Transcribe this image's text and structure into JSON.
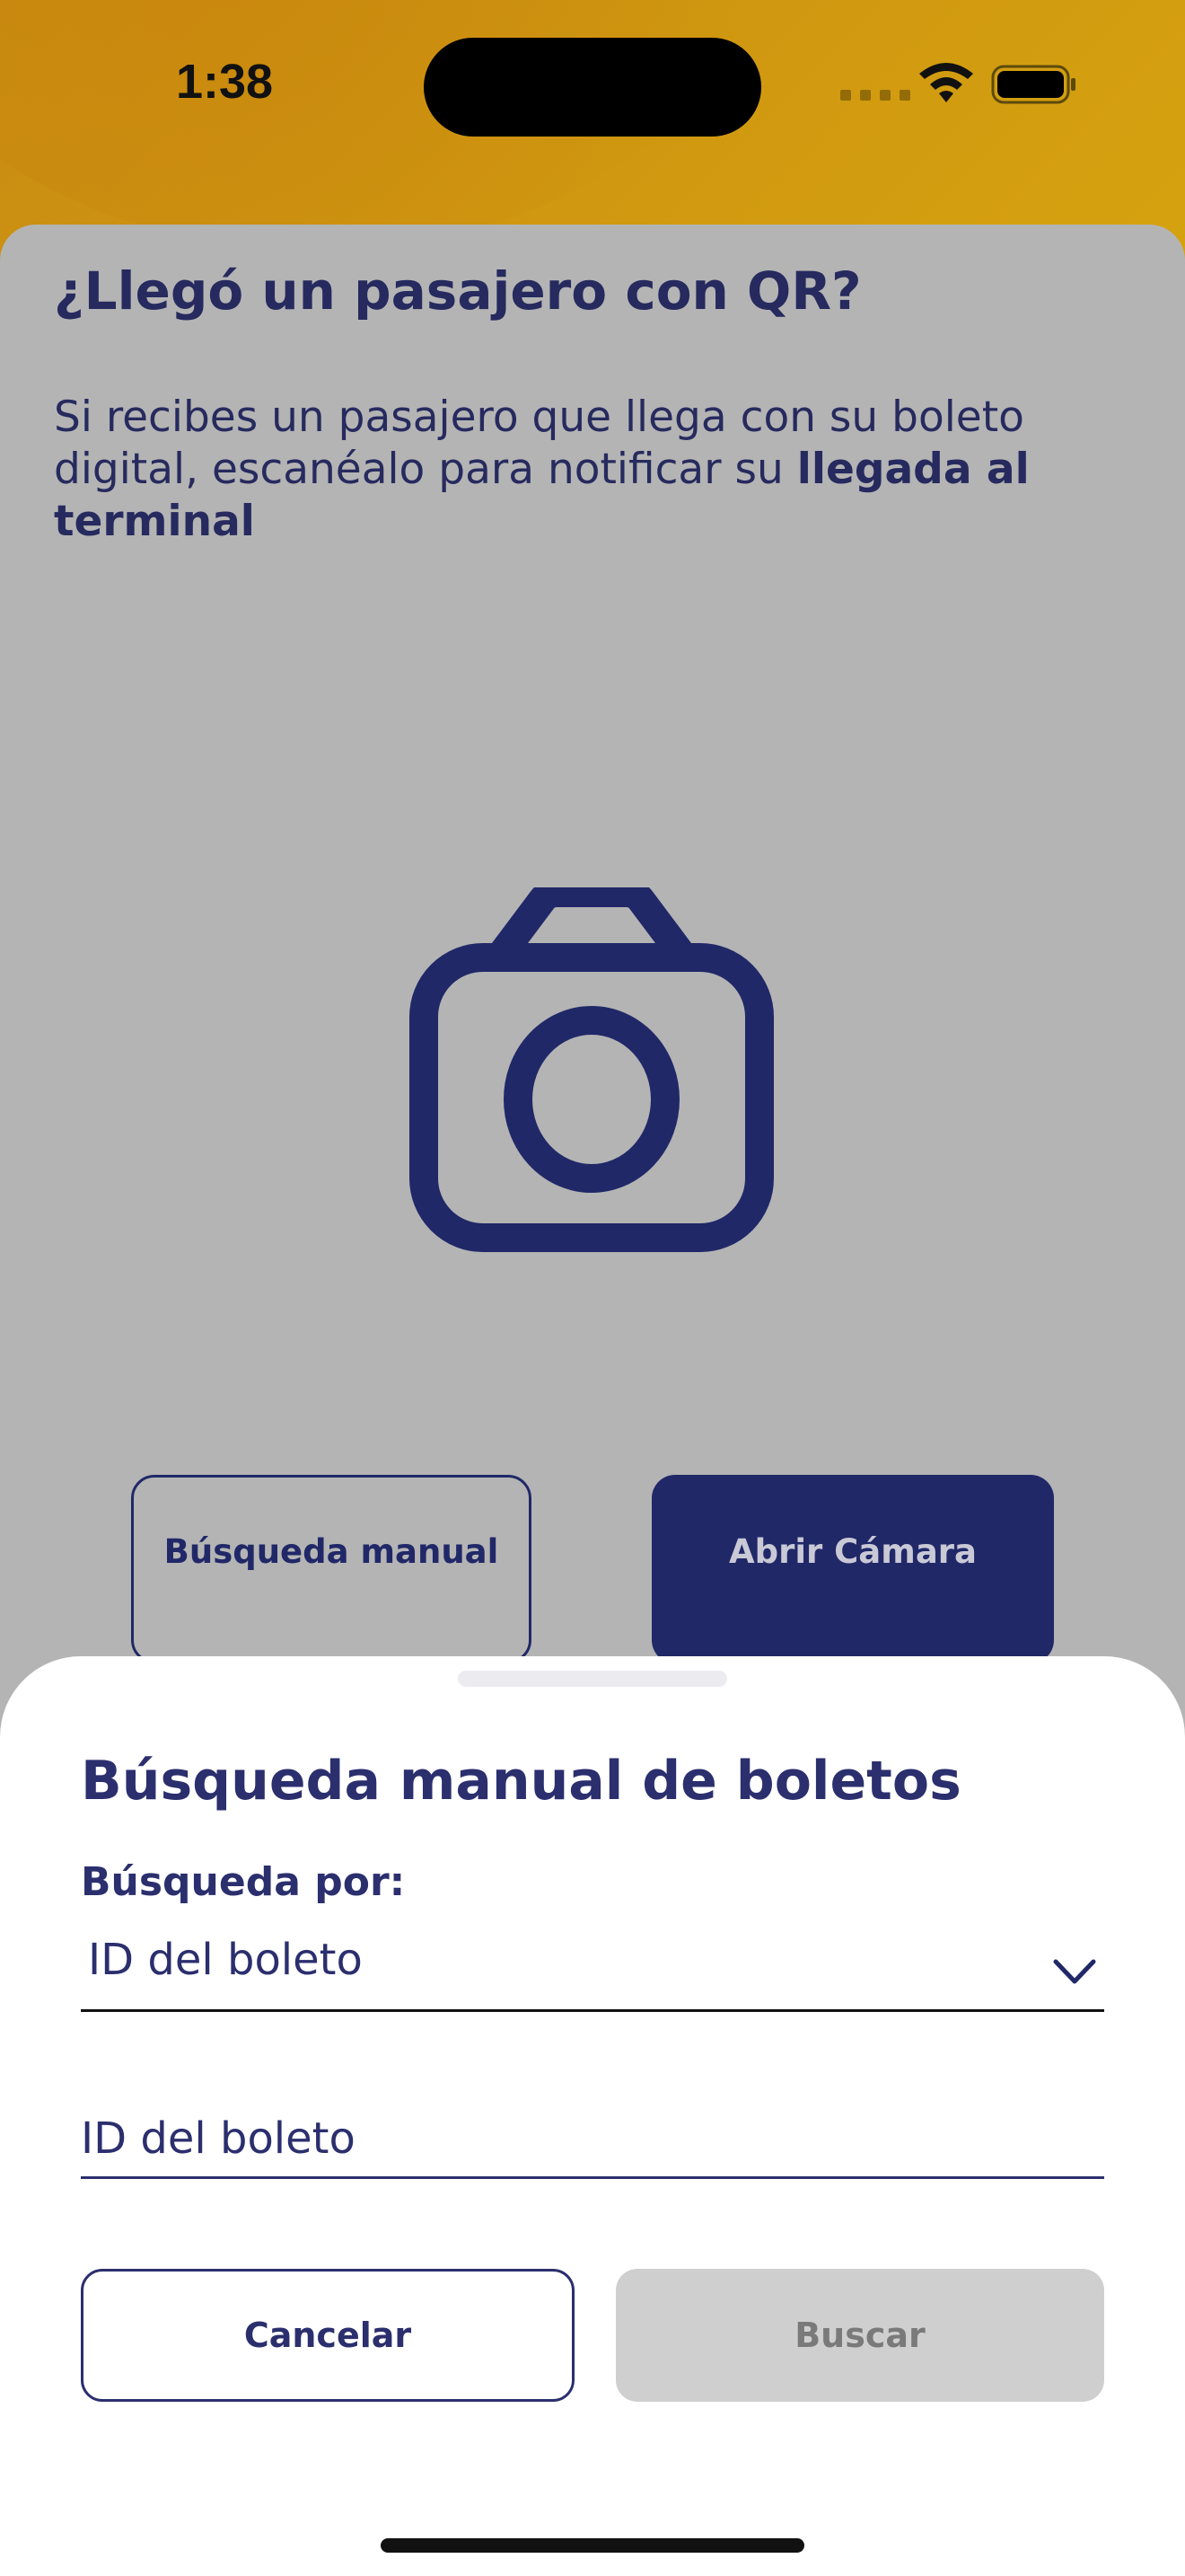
{
  "status_bar": {
    "time": "1:38"
  },
  "background_screen": {
    "title": "¿Llegó un pasajero con QR?",
    "description_plain": "Si recibes un pasajero que llega con su boleto digital, escanéalo para notificar su ",
    "description_bold": "llegada al terminal",
    "manual_search_label": "Búsqueda manual",
    "open_camera_label": "Abrir Cámara",
    "icon": "camera-icon"
  },
  "sheet": {
    "title": "Búsqueda manual de boletos",
    "filter_label": "Búsqueda por:",
    "filter_selected": "ID del boleto",
    "input_placeholder": "ID del boleto",
    "input_value": "",
    "cancel_label": "Cancelar",
    "search_label": "Buscar"
  },
  "colors": {
    "brand_navy": "#202868",
    "brand_yellow": "#d6a30f",
    "disabled_gray": "#cfcfcf"
  }
}
